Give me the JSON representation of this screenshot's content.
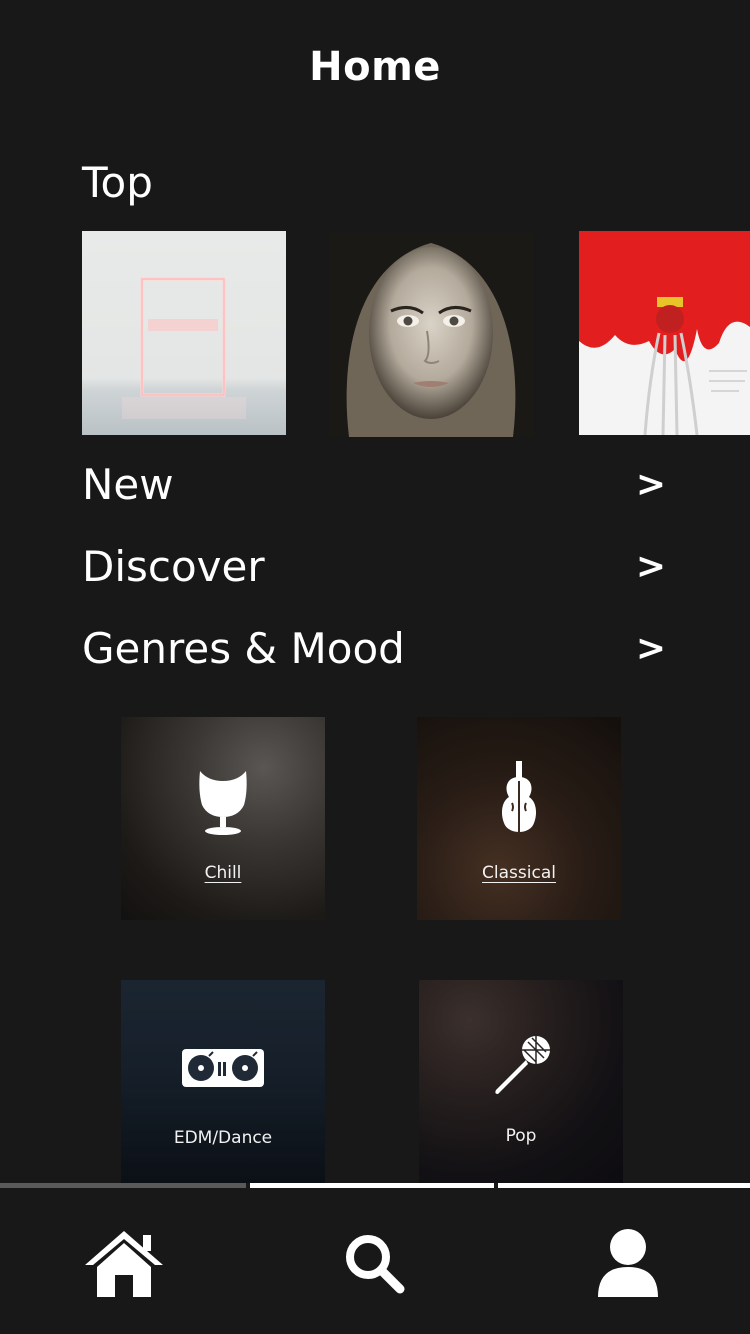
{
  "header": {
    "title": "Home"
  },
  "top": {
    "title": "Top",
    "albums": [
      {
        "name": "album-cover-1975"
      },
      {
        "name": "album-cover-adele-25"
      },
      {
        "name": "album-cover-anti"
      }
    ]
  },
  "links": [
    {
      "label": "New",
      "chevron": ">"
    },
    {
      "label": "Discover",
      "chevron": ">"
    },
    {
      "label": "Genres & Mood",
      "chevron": ">"
    }
  ],
  "genres": [
    {
      "label": "Chill",
      "icon": "egg-chair-icon"
    },
    {
      "label": "Classical",
      "icon": "violin-icon"
    },
    {
      "label": "EDM/Dance",
      "icon": "turntable-icon"
    },
    {
      "label": "Pop",
      "icon": "microphone-icon"
    }
  ],
  "tabbar": {
    "items": [
      {
        "name": "home",
        "icon": "home-icon"
      },
      {
        "name": "search",
        "icon": "search-icon"
      },
      {
        "name": "profile",
        "icon": "user-icon"
      }
    ]
  },
  "colors": {
    "background": "#181818",
    "text": "#ffffff",
    "cover_red": "#e02020"
  }
}
